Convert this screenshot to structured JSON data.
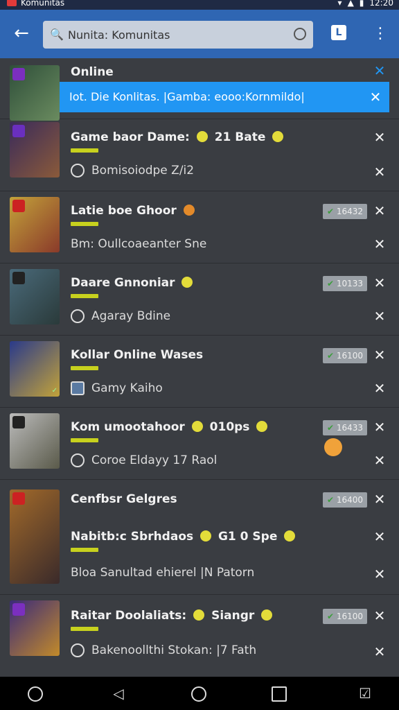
{
  "status": {
    "app_label": "Komunitas",
    "time": "12:20"
  },
  "search": {
    "value": "Nunita: Komunitas",
    "placeholder": "Nunita: Komunitas"
  },
  "appbar": {
    "back_icon": "arrow-left-icon",
    "menu_icon": "more-vert-icon",
    "lbtn": "L"
  },
  "banner": {
    "text": "Iot. Die Konlitas. |Gamba: eooo:Kornmildo|"
  },
  "items": [
    {
      "title": "Online",
      "subtitle": "",
      "tag": ""
    },
    {
      "title": "Game baor Dame:",
      "title_suffix": "21 Bate",
      "subtitle": "Bomisoiodpe Z/i2",
      "tag": ""
    },
    {
      "title": "Latie boe Ghoor",
      "subtitle": "Bm: Oullcoaeanter Sne",
      "tag": "16432"
    },
    {
      "title": "Daare Gnnoniar",
      "subtitle": "Agaray Bdine",
      "tag": "10133"
    },
    {
      "title": "Kollar Online Wases",
      "subtitle": "Gamy Kaiho",
      "tag": "16100"
    },
    {
      "title": "Kom umootahoor",
      "title_suffix": "010ps",
      "subtitle": "Coroe Eldayy 17 Raol",
      "tag": "16433"
    },
    {
      "title": "Cenfbsr Gelgres",
      "title2": "Nabitb:c Sbrhdaos",
      "title2_suffix": "G1 0 Spe",
      "subtitle": "Bloa Sanultad ehierel |N Patorn",
      "tag": "16400"
    },
    {
      "title": "Raitar Doolaliats:",
      "title_suffix": "Siangr",
      "subtitle": "Bakenoollthi Stokan: |7 Fath",
      "tag": "16100"
    }
  ],
  "nav": {
    "home": "home-circle-icon",
    "back": "nav-back-icon",
    "square": "recents-icon",
    "extra": "screenshot-icon"
  }
}
